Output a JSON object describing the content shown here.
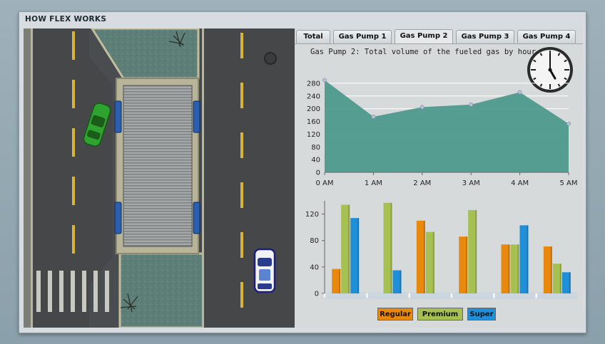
{
  "panel": {
    "title": "HOW FLEX WORKS"
  },
  "tabs": [
    {
      "label": "Total",
      "active": false
    },
    {
      "label": "Gas Pump 1",
      "active": false
    },
    {
      "label": "Gas Pump 2",
      "active": true
    },
    {
      "label": "Gas Pump 3",
      "active": false
    },
    {
      "label": "Gas Pump 4",
      "active": false
    }
  ],
  "clock": {
    "hour": 5,
    "minute": 0
  },
  "colors": {
    "area": "#4e9a8c",
    "regular": "#e8890e",
    "premium": "#a6c052",
    "super": "#1f8fd8",
    "road": "#454749",
    "grass": "#5d7f78",
    "lane": "#d8b43a"
  },
  "chart_data": [
    {
      "type": "area",
      "title": "Gas Pump 2: Total volume of the fueled gas by hour",
      "categories": [
        "0 AM",
        "1 AM",
        "2 AM",
        "3 AM",
        "4 AM",
        "5 AM"
      ],
      "values": [
        290,
        175,
        205,
        213,
        252,
        153
      ],
      "ylim": [
        0,
        300
      ],
      "yticks": [
        0,
        40,
        80,
        120,
        160,
        200,
        240,
        280
      ],
      "grid": true
    },
    {
      "type": "bar",
      "categories": [
        "0 AM",
        "1 AM",
        "2 AM",
        "3 AM",
        "4 AM",
        "5 AM"
      ],
      "ylim": [
        0,
        140
      ],
      "yticks": [
        0,
        40,
        80,
        120
      ],
      "series": [
        {
          "name": "Regular",
          "values": [
            37,
            0,
            110,
            86,
            74,
            71
          ]
        },
        {
          "name": "Premium",
          "values": [
            134,
            137,
            93,
            126,
            74,
            45
          ]
        },
        {
          "name": "Super",
          "values": [
            114,
            35,
            0,
            0,
            103,
            32
          ]
        }
      ],
      "legend": "bottom"
    }
  ]
}
